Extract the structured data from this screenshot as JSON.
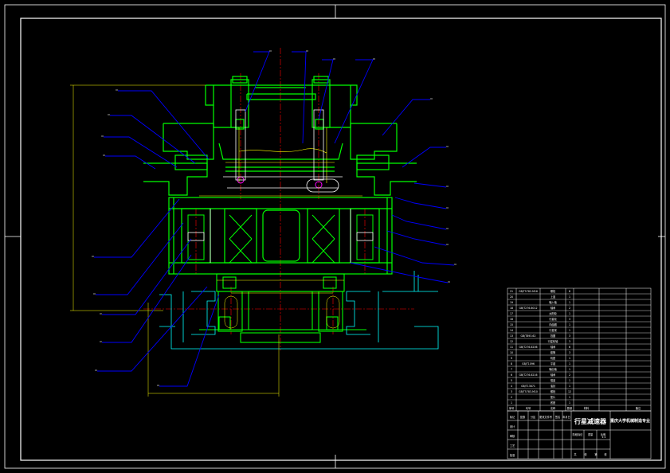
{
  "drawing": {
    "title": "行星减速器",
    "school": "重庆大学机械制造专业",
    "sheet_scale": "1:1",
    "colors": {
      "background": "#000000",
      "frame": "#ffffff",
      "structure": "#00ff00",
      "hidden_gear": "#00ffff",
      "leader": "#0000ff",
      "centerline": "#ff0000",
      "dimension": "#ffff00",
      "highlight": "#ff00ff",
      "housing": "#ffffff"
    }
  },
  "title_block": {
    "headers": [
      "标记",
      "处数",
      "分区",
      "更改文件号",
      "签名",
      "年月日"
    ],
    "roles": [
      "设计",
      "审核",
      "工艺",
      "批准"
    ],
    "stage_labels": [
      "阶段标记",
      "重量",
      "比例"
    ],
    "sheet_labels": [
      "共",
      "张",
      "第",
      "张"
    ]
  },
  "bom": {
    "rows": [
      {
        "no": "21",
        "code": "GB/T5782-M16",
        "name": "螺栓",
        "qty": "8"
      },
      {
        "no": "20",
        "code": "",
        "name": "上盖",
        "qty": "1"
      },
      {
        "no": "19",
        "code": "",
        "name": "输入轴",
        "qty": "1"
      },
      {
        "no": "18",
        "code": "GB/T276-6012",
        "name": "轴承",
        "qty": "2"
      },
      {
        "no": "17",
        "code": "",
        "name": "太阳轮",
        "qty": "1"
      },
      {
        "no": "16",
        "code": "",
        "name": "行星轮",
        "qty": "3"
      },
      {
        "no": "15",
        "code": "",
        "name": "内齿圈",
        "qty": "1"
      },
      {
        "no": "14",
        "code": "",
        "name": "行星架",
        "qty": "1"
      },
      {
        "no": "13",
        "code": "GB/T893-62",
        "name": "挡圈",
        "qty": "3"
      },
      {
        "no": "12",
        "code": "",
        "name": "行星轮轴",
        "qty": "3"
      },
      {
        "no": "11",
        "code": "GB/T276-6206",
        "name": "轴承",
        "qty": "6"
      },
      {
        "no": "10",
        "code": "",
        "name": "套筒",
        "qty": "3"
      },
      {
        "no": "9",
        "code": "",
        "name": "机座",
        "qty": "1"
      },
      {
        "no": "8",
        "code": "GB/T1096",
        "name": "平键",
        "qty": "1"
      },
      {
        "no": "7",
        "code": "",
        "name": "输出轴",
        "qty": "1"
      },
      {
        "no": "6",
        "code": "GB/T276-6216",
        "name": "轴承",
        "qty": "2"
      },
      {
        "no": "5",
        "code": "",
        "name": "端盖",
        "qty": "1"
      },
      {
        "no": "4",
        "code": "GB/T13871",
        "name": "油封",
        "qty": "1"
      },
      {
        "no": "3",
        "code": "GB/T5783-M10",
        "name": "螺栓",
        "qty": "12"
      },
      {
        "no": "2",
        "code": "",
        "name": "垫片",
        "qty": "1"
      },
      {
        "no": "1",
        "code": "",
        "name": "底座",
        "qty": "1"
      }
    ],
    "header": {
      "no": "序号",
      "code": "代号",
      "name": "名称",
      "qty": "数量",
      "material": "材料",
      "note": "备注"
    }
  }
}
